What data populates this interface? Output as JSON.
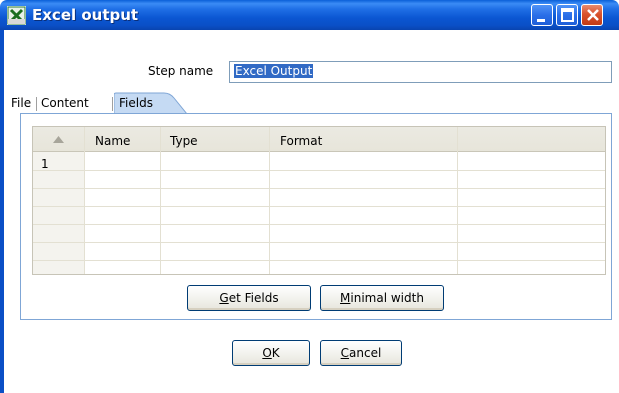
{
  "window": {
    "title": "Excel output",
    "icon": "spoon-excel-icon"
  },
  "step": {
    "label": "Step name",
    "value": "Excel Output"
  },
  "tabs": [
    {
      "label": "File",
      "active": false
    },
    {
      "label": "Content",
      "active": false
    },
    {
      "label": "Fields",
      "active": true
    }
  ],
  "grid": {
    "columns": [
      "",
      "Name",
      "Type",
      "Format",
      ""
    ],
    "rows": [
      {
        "num": "1",
        "name": "",
        "type": "",
        "format": ""
      }
    ]
  },
  "buttons": {
    "get_fields": {
      "pre": "",
      "key": "G",
      "post": "et Fields"
    },
    "minimal_width": {
      "pre": "",
      "key": "M",
      "post": "inimal width"
    },
    "ok": {
      "pre": "",
      "key": "O",
      "post": "K"
    },
    "cancel": {
      "pre": "",
      "key": "C",
      "post": "ancel"
    }
  },
  "colors": {
    "titlebar": "#0a56d2",
    "close_button": "#d9532e",
    "selection": "#316ac5",
    "active_tab": "#c5daf3"
  }
}
